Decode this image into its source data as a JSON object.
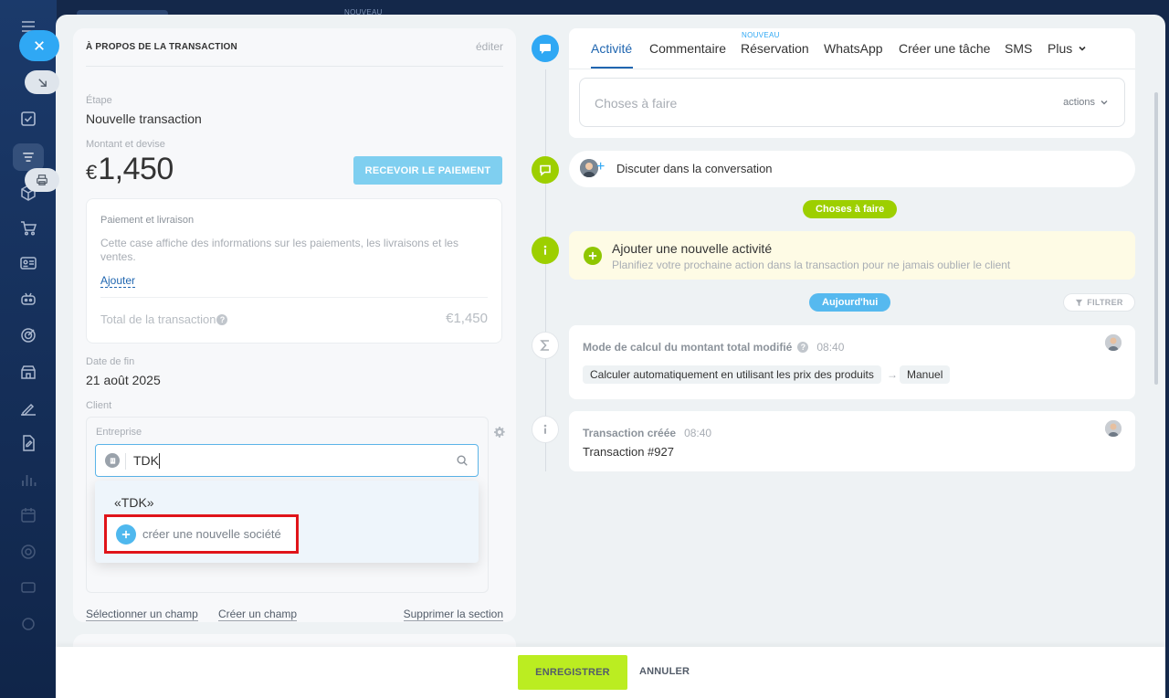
{
  "topbar": {
    "new_label": "NOUVEAU"
  },
  "deal": {
    "section_title": "À PROPOS DE LA TRANSACTION",
    "edit_label": "éditer",
    "stage_label": "Étape",
    "stage_value": "Nouvelle transaction",
    "amount_label": "Montant et devise",
    "currency_symbol": "€",
    "amount_value": "1,450",
    "receive_payment_label": "RECEVOIR LE PAIEMENT",
    "payment": {
      "title": "Paiement et livraison",
      "description": "Cette case affiche des informations sur les paiements, les livraisons et les ventes.",
      "add_label": "Ajouter",
      "total_label": "Total de la transaction",
      "total_value": "€1,450"
    },
    "end_date_label": "Date de fin",
    "end_date_value": "21 août 2025",
    "client_label": "Client",
    "company_label": "Entreprise",
    "company_search_value": "TDK",
    "dropdown": {
      "result_label": "«TDK»",
      "create_label": "créer une nouvelle société"
    },
    "select_field_label": "Sélectionner un champ",
    "create_field_label": "Créer un champ",
    "delete_section_label": "Supprimer la section"
  },
  "footer": {
    "save_label": "ENREGISTRER",
    "cancel_label": "ANNULER"
  },
  "timeline": {
    "tabs": [
      {
        "label": "Activité",
        "active": true
      },
      {
        "label": "Commentaire"
      },
      {
        "label": "Réservation",
        "badge": "NOUVEAU"
      },
      {
        "label": "WhatsApp"
      },
      {
        "label": "Créer une tâche"
      },
      {
        "label": "SMS"
      },
      {
        "label": "Plus"
      }
    ],
    "todo_placeholder": "Choses à faire",
    "actions_label": "actions",
    "chat_label": "Discuter dans la conversation",
    "todo_badge": "Choses à faire",
    "add_activity_title": "Ajouter une nouvelle activité",
    "add_activity_desc": "Planifiez votre prochaine action dans la transaction pour ne jamais oublier le client",
    "today_badge": "Aujourd'hui",
    "filter_label": "FILTRER",
    "events": [
      {
        "title": "Mode de calcul du montant total modifié",
        "time": "08:40",
        "from": "Calculer automatiquement en utilisant les prix des produits",
        "to": "Manuel"
      },
      {
        "title": "Transaction créée",
        "time": "08:40",
        "body": "Transaction #927"
      }
    ]
  },
  "colors": {
    "accent": "#2fa8f4",
    "save_green": "#bbed21",
    "highlight_red": "#e0141a",
    "sidebar": "#14284a"
  }
}
